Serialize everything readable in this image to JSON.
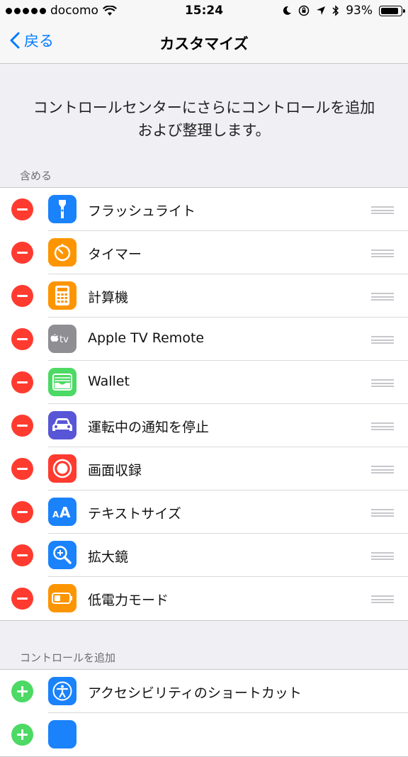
{
  "status_bar": {
    "carrier": "docomo",
    "time": "15:24",
    "battery": "93%",
    "battery_level": 0.93
  },
  "nav": {
    "back_label": "戻る",
    "title": "カスタマイズ"
  },
  "description": "コントロールセンターにさらにコントロールを追加および整理します。",
  "included": {
    "header": "含める",
    "items": [
      {
        "label": "フラッシュライト",
        "icon": "flashlight-icon",
        "color": "#1a82fb"
      },
      {
        "label": "タイマー",
        "icon": "timer-icon",
        "color": "#fd9500"
      },
      {
        "label": "計算機",
        "icon": "calculator-icon",
        "color": "#fd9500"
      },
      {
        "label": "Apple TV Remote",
        "icon": "apple-tv-icon",
        "color": "#8e8e93"
      },
      {
        "label": "Wallet",
        "icon": "wallet-icon",
        "color": "#4cd964"
      },
      {
        "label": "運転中の通知を停止",
        "icon": "car-icon",
        "color": "#5856d6"
      },
      {
        "label": "画面収録",
        "icon": "record-icon",
        "color": "#ff3b30"
      },
      {
        "label": "テキストサイズ",
        "icon": "text-size-icon",
        "color": "#1a82fb"
      },
      {
        "label": "拡大鏡",
        "icon": "magnifier-icon",
        "color": "#1a82fb"
      },
      {
        "label": "低電力モード",
        "icon": "battery-icon",
        "color": "#fd9500"
      }
    ]
  },
  "more": {
    "header": "コントロールを追加",
    "items": [
      {
        "label": "アクセシビリティのショートカット",
        "icon": "accessibility-icon",
        "color": "#1a82fb"
      },
      {
        "label": "",
        "icon": "partial-app-icon",
        "color": "#1a82fb"
      }
    ]
  }
}
